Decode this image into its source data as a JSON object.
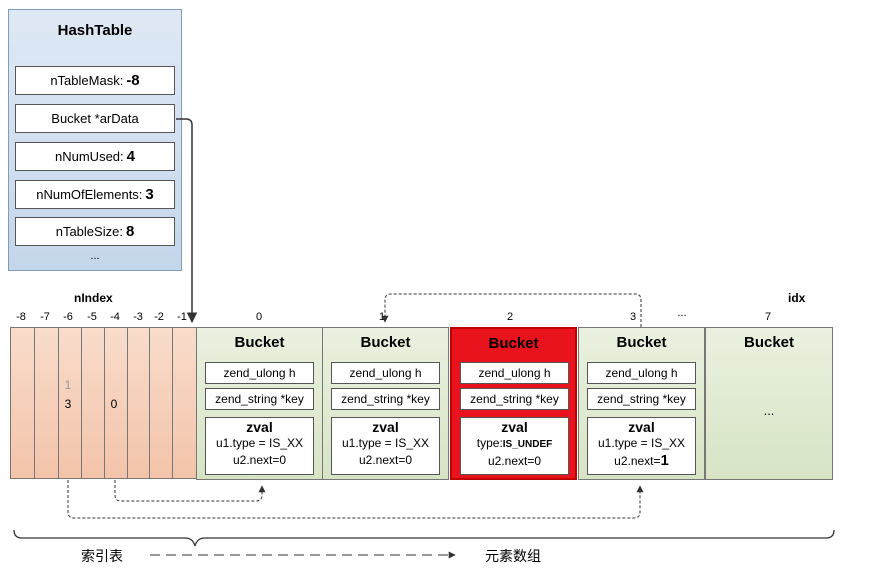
{
  "hashtable": {
    "title": "HashTable",
    "fields": [
      {
        "label": "nTableMask:",
        "value": "-8"
      },
      {
        "label": "Bucket  *arData",
        "value": ""
      },
      {
        "label": "nNumUsed:",
        "value": "4"
      },
      {
        "label": "nNumOfElements:",
        "value": "3"
      },
      {
        "label": "nTableSize:",
        "value": "8"
      }
    ],
    "ellipsis": "..."
  },
  "nindex": {
    "title": "nIndex",
    "labels": [
      "-8",
      "-7",
      "-6",
      "-5",
      "-4",
      "-3",
      "-2",
      "-1"
    ],
    "cell_minus6_old": "1",
    "cell_minus6": "3",
    "cell_minus4": "0"
  },
  "idx": {
    "title": "idx",
    "labels": [
      "0",
      "1",
      "2",
      "3",
      "...",
      "7"
    ]
  },
  "buckets": [
    {
      "title": "Bucket",
      "h": "zend_ulong h",
      "key": "zend_string *key",
      "zval": "zval",
      "type_label": "u1.type = IS_XX",
      "type_value": "",
      "next_label": "u2.next=0",
      "next_value": ""
    },
    {
      "title": "Bucket",
      "h": "zend_ulong h",
      "key": "zend_string *key",
      "zval": "zval",
      "type_label": "u1.type = IS_XX",
      "type_value": "",
      "next_label": "u2.next=0",
      "next_value": ""
    },
    {
      "title": "Bucket",
      "h": "zend_ulong h",
      "key": "zend_string *key",
      "zval": "zval",
      "type_label": "type:",
      "type_value": "IS_UNDEF",
      "next_label": "u2.next=0",
      "next_value": ""
    },
    {
      "title": "Bucket",
      "h": "zend_ulong h",
      "key": "zend_string *key",
      "zval": "zval",
      "type_label": "u1.type = IS_XX",
      "type_value": "",
      "next_label": "u2.next=",
      "next_value": "1"
    }
  ],
  "bucket_last": {
    "title": "Bucket",
    "ellipsis": "..."
  },
  "bottom": {
    "left": "索引表",
    "right": "元素数组"
  },
  "colors": {
    "deleted_bucket": "#e8131c",
    "bucket": "#d7e4c4",
    "nindex": "#f3c4aa",
    "hashtable": "#c4d6eb"
  }
}
